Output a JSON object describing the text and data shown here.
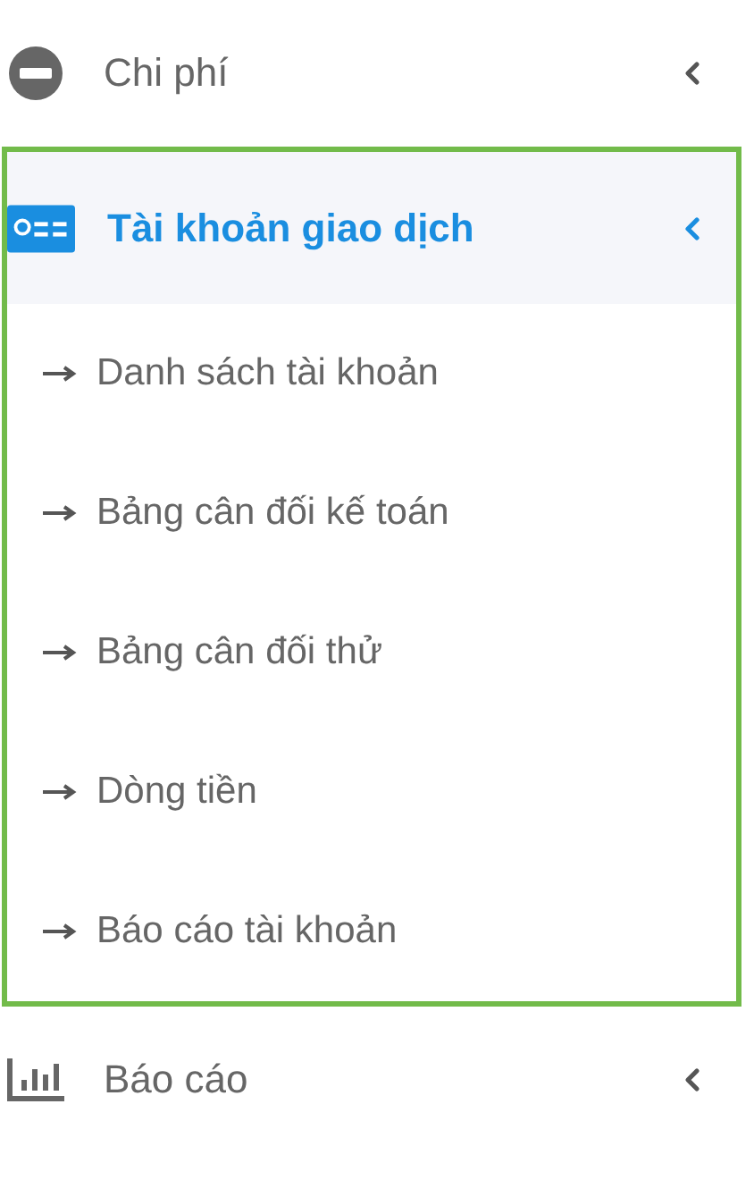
{
  "menu": [
    {
      "label": "Chi phí",
      "selected": false,
      "outlined": false
    },
    {
      "label": "Tài khoản giao dịch",
      "selected": true,
      "expanded": true,
      "outlined": true,
      "children": [
        {
          "label": "Danh sách tài khoản"
        },
        {
          "label": "Bảng cân đối kế toán"
        },
        {
          "label": "Bảng cân đối thử"
        },
        {
          "label": "Dòng tiền"
        },
        {
          "label": "Báo cáo tài khoản"
        }
      ]
    },
    {
      "label": "Báo cáo",
      "selected": false,
      "outlined": false
    }
  ]
}
